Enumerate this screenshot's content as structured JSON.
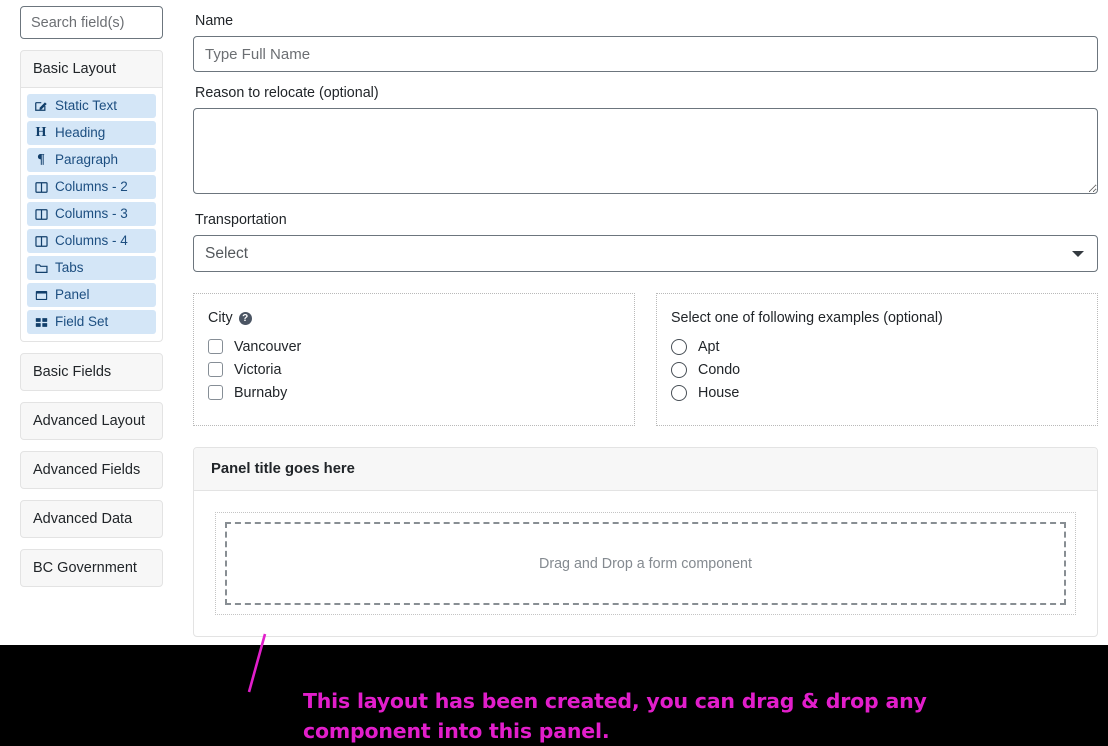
{
  "sidebar": {
    "search": {
      "placeholder": "Search field(s)",
      "value": ""
    },
    "groups": [
      {
        "title": "Basic Layout",
        "items": [
          {
            "label": "Static Text",
            "icon": "pencil-square-icon"
          },
          {
            "label": "Heading",
            "icon": "heading-icon"
          },
          {
            "label": "Paragraph",
            "icon": "paragraph-icon"
          },
          {
            "label": "Columns - 2",
            "icon": "columns-icon"
          },
          {
            "label": "Columns - 3",
            "icon": "columns-icon"
          },
          {
            "label": "Columns - 4",
            "icon": "columns-icon"
          },
          {
            "label": "Tabs",
            "icon": "folder-icon"
          },
          {
            "label": "Panel",
            "icon": "window-icon"
          },
          {
            "label": "Field Set",
            "icon": "grid-icon"
          }
        ]
      }
    ],
    "categories": [
      {
        "label": "Basic Fields"
      },
      {
        "label": "Advanced Layout"
      },
      {
        "label": "Advanced Fields"
      },
      {
        "label": "Advanced Data"
      },
      {
        "label": "BC Government"
      }
    ]
  },
  "form": {
    "name": {
      "label": "Name",
      "placeholder": "Type Full Name",
      "value": ""
    },
    "reason": {
      "label": "Reason to relocate (optional)",
      "placeholder": "",
      "value": ""
    },
    "transportation": {
      "label": "Transportation",
      "selected": "Select"
    },
    "city": {
      "label": "City",
      "help_icon": "help-circle-icon",
      "options": [
        {
          "label": "Vancouver",
          "checked": false
        },
        {
          "label": "Victoria",
          "checked": false
        },
        {
          "label": "Burnaby",
          "checked": false
        }
      ]
    },
    "examples": {
      "label": "Select one of following examples (optional)",
      "options": [
        {
          "label": "Apt",
          "selected": false
        },
        {
          "label": "Condo",
          "selected": false
        },
        {
          "label": "House",
          "selected": false
        }
      ]
    },
    "panel": {
      "title": "Panel title goes here",
      "dropzone_text": "Drag and Drop a form component"
    }
  },
  "annotation": {
    "text": "This layout has been created, you can drag & drop any\ncomponent into this panel.",
    "color": "#e21ecb",
    "background": "#000000"
  },
  "colors": {
    "component_chip_bg": "#d4e6f7",
    "component_chip_text": "#1c4e80",
    "group_header_bg": "#f7f7f7",
    "border": "#e3e3e3"
  }
}
